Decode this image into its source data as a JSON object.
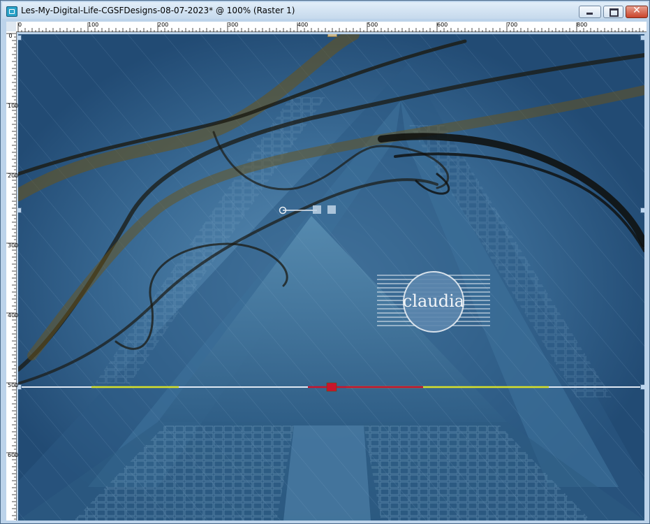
{
  "window": {
    "title": "Les-My-Digital-Life-CGSFDesigns-08-07-2023* @ 100% (Raster 1)",
    "controls": [
      "minimize-icon",
      "maximize-icon",
      "close-icon"
    ]
  },
  "ruler": {
    "top_labels": [
      "0",
      "100",
      "200",
      "300",
      "400",
      "500",
      "600",
      "700",
      "800"
    ],
    "left_labels": [
      "0",
      "100",
      "200",
      "300",
      "400",
      "500",
      "600"
    ]
  },
  "canvas": {
    "watermark_text": "claudia",
    "colors": {
      "background": "#2c5680",
      "guide": "#dfe8f2",
      "smoke": "#1b1a12",
      "smoke_gold": "#6b5418",
      "selection_red": "#c8142c",
      "selection_yellow": "#d7e02a"
    }
  }
}
